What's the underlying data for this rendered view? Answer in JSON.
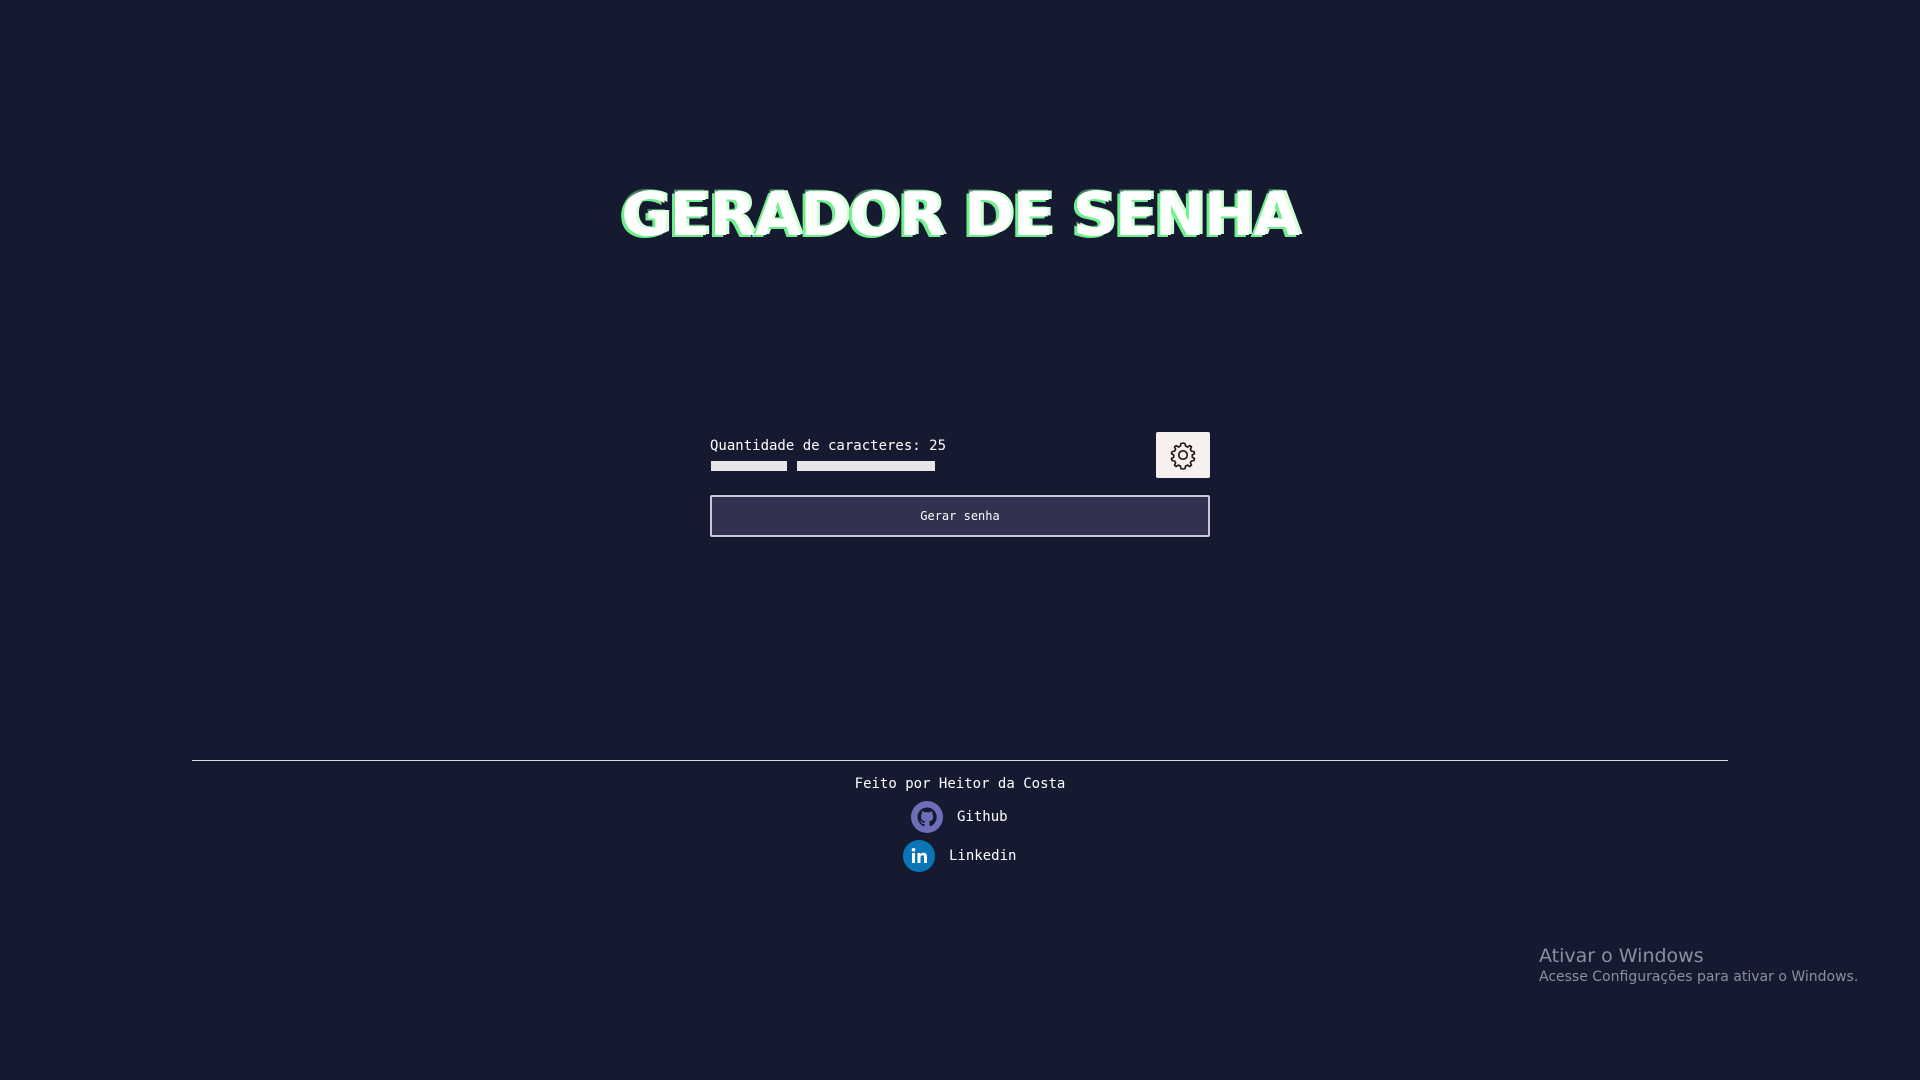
{
  "app": {
    "title": "GERADOR DE SENHA"
  },
  "controls": {
    "length_label": "Quantidade de caracteres: 25",
    "length_value": 25,
    "slider_level_percent": 34,
    "settings_icon": "gear-icon",
    "generate_label": "Gerar senha"
  },
  "footer": {
    "credit": "Feito por Heitor da Costa",
    "links": [
      {
        "label": "Github",
        "icon": "github-icon"
      },
      {
        "label": "Linkedin",
        "icon": "linkedin-icon"
      }
    ]
  },
  "watermark": {
    "title": "Ativar o Windows",
    "subtitle": "Acesse Configurações para ativar o Windows."
  },
  "colors": {
    "background": "#151a31",
    "button_bg": "#313150",
    "settings_bg": "#f6f1ef",
    "title_glow": "#6ef08c",
    "github_icon": "#6e6eb8",
    "linkedin_icon": "#0a76b7"
  }
}
